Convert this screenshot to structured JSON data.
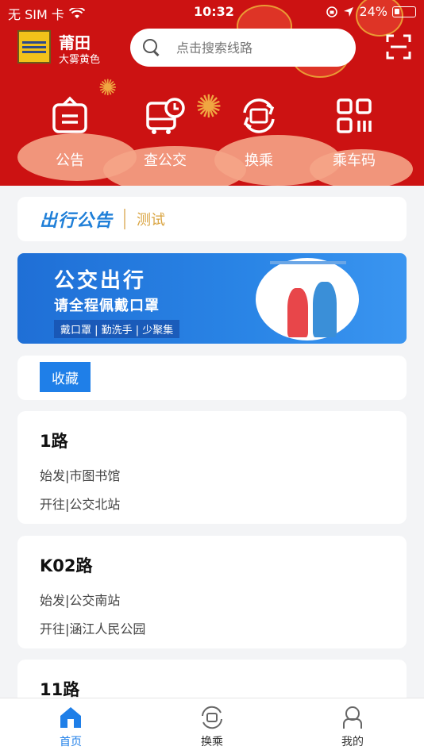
{
  "status_bar": {
    "carrier": "无 SIM 卡",
    "time": "10:32",
    "battery": "24%"
  },
  "header": {
    "city": "莆田",
    "weather": "大雾黄色",
    "search_placeholder": "点击搜索线路"
  },
  "quick_actions": [
    {
      "label": "公告",
      "icon": "announcement-icon"
    },
    {
      "label": "查公交",
      "icon": "bus-schedule-icon"
    },
    {
      "label": "换乘",
      "icon": "transfer-icon"
    },
    {
      "label": "乘车码",
      "icon": "qr-code-icon"
    }
  ],
  "notice": {
    "logo_text": "出行公告",
    "text": "测试"
  },
  "banner": {
    "title": "公交出行",
    "subtitle": "请全程佩戴口罩",
    "tips": "戴口罩 | 勤洗手 | 少聚集"
  },
  "favorites_tab": "收藏",
  "routes": [
    {
      "name": "1路",
      "start": "始发|市图书馆",
      "dest": "开往|公交北站"
    },
    {
      "name": "K02路",
      "start": "始发|公交南站",
      "dest": "开往|涵江人民公园"
    },
    {
      "name": "11路"
    }
  ],
  "bottom_nav": [
    {
      "label": "首页",
      "icon": "home-icon",
      "active": true
    },
    {
      "label": "换乘",
      "icon": "transfer-icon",
      "active": false
    },
    {
      "label": "我的",
      "icon": "profile-icon",
      "active": false
    }
  ],
  "colors": {
    "header_red": "#cc1212",
    "accent_blue": "#1f7fe8",
    "notice_gold": "#d9a441"
  }
}
